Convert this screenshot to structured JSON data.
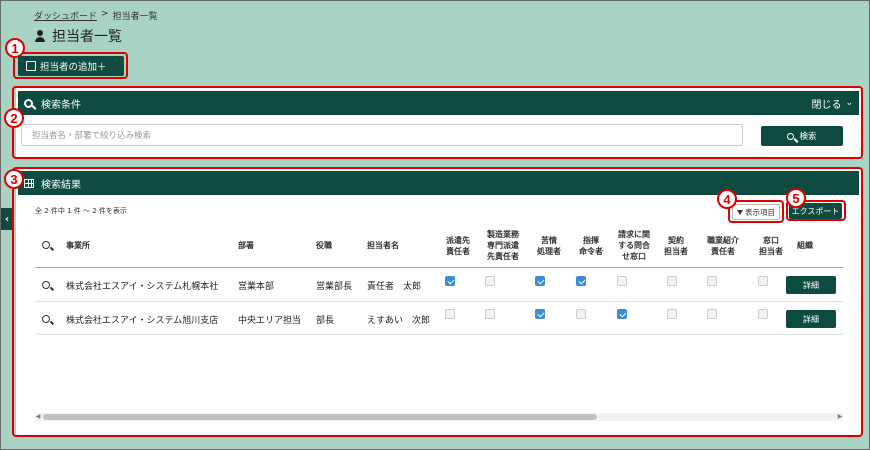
{
  "breadcrumb": {
    "home": "ダッシュボード",
    "separator": ">",
    "current": "担当者一覧"
  },
  "page_title": "担当者一覧",
  "add_button": "担当者の追加＋",
  "search_panel": {
    "title": "検索条件",
    "toggle": "閉じる",
    "placeholder": "担当者名・部署で絞り込み検索",
    "button": "検索"
  },
  "results_panel": {
    "title": "検索結果",
    "count_text": "全 2 件中 1 件 ～ 2 件を表示",
    "display_items_button": "表示項目",
    "export_button": "エクスポート"
  },
  "annotations": [
    "1",
    "2",
    "3",
    "4",
    "5"
  ],
  "table": {
    "headers": [
      "事業所",
      "部署",
      "役職",
      "担当者名",
      "派遣先責任者",
      "製造業務専門派遣先責任者",
      "苦情処理者",
      "指揮命令者",
      "請求に関する問合せ窓口",
      "契約担当者",
      "職業紹介責任者",
      "窓口担当者",
      "組織"
    ],
    "rows": [
      {
        "office": "株式会社エスアイ・システム札幌本社",
        "dept": "営業本部",
        "position": "営業部長",
        "name": "責任者　太郎",
        "checks": [
          true,
          false,
          true,
          true,
          false,
          false,
          false,
          false
        ],
        "detail": "詳細"
      },
      {
        "office": "株式会社エスアイ・システム旭川支店",
        "dept": "中央エリア担当",
        "position": "部長",
        "name": "えすあい　次郎",
        "checks": [
          false,
          false,
          true,
          false,
          true,
          false,
          false,
          false
        ],
        "detail": "詳細"
      }
    ]
  },
  "colors": {
    "primary": "#0d4a3f",
    "background": "#a9d3c2",
    "annotation": "#e00000",
    "checkbox_on": "#3a8ed8"
  }
}
